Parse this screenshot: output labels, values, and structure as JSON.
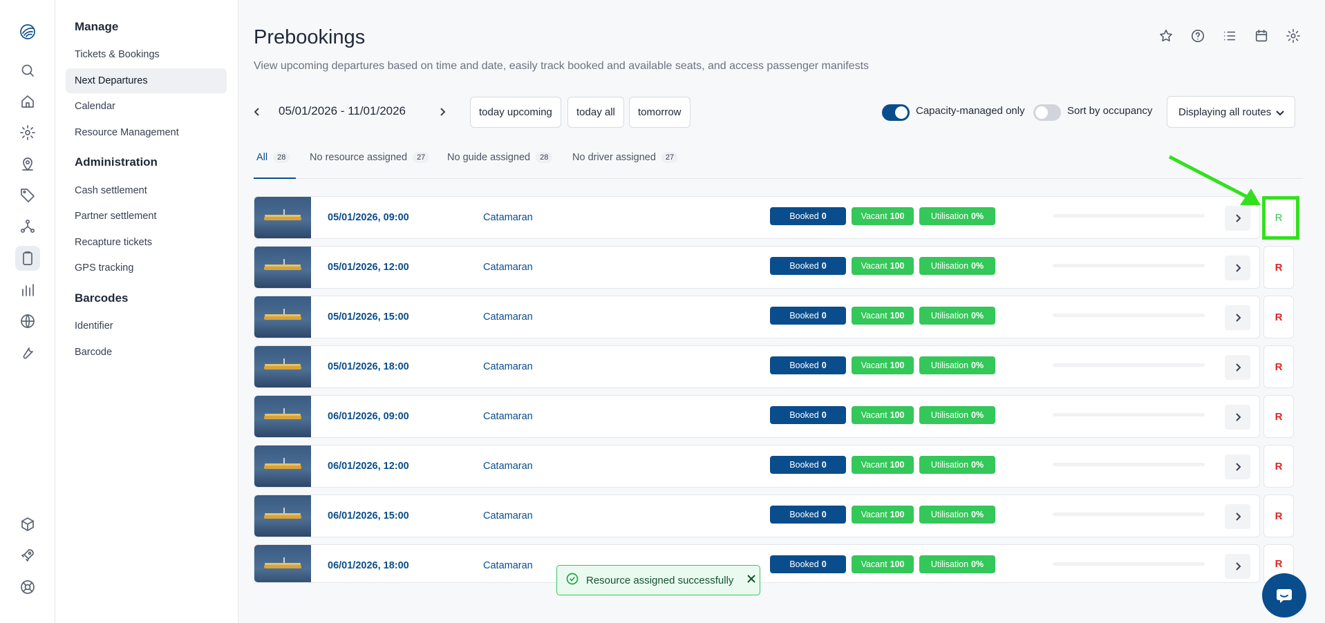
{
  "sidebar_icons": [
    "logo-icon",
    "search-icon",
    "home-icon",
    "gear-icon",
    "user-location-icon",
    "tag-icon",
    "network-icon",
    "clipboard-icon",
    "bar-chart-icon",
    "globe-icon",
    "wrench-icon",
    "cube-icon",
    "rocket-icon",
    "lifebuoy-icon"
  ],
  "subnav": {
    "manage_title": "Manage",
    "manage_items": [
      "Tickets & Bookings",
      "Next Departures",
      "Calendar",
      "Resource Management"
    ],
    "admin_title": "Administration",
    "admin_items": [
      "Cash settlement",
      "Partner settlement",
      "Recapture tickets",
      "GPS tracking"
    ],
    "barcodes_title": "Barcodes",
    "barcodes_items": [
      "Identifier",
      "Barcode"
    ]
  },
  "header": {
    "title": "Prebookings",
    "subtitle": "View upcoming departures based on time and date, easily track booked and available seats, and access passenger manifests"
  },
  "toolbar": {
    "date_range": "05/01/2026 - 11/01/2026",
    "today_upcoming": "today upcoming",
    "today_all": "today all",
    "tomorrow": "tomorrow",
    "capacity_label": "Capacity-managed only",
    "capacity_on": true,
    "sort_label": "Sort by occupancy",
    "sort_on": false,
    "routes_label": "Displaying all routes"
  },
  "tabs": [
    {
      "label": "All",
      "count": "28"
    },
    {
      "label": "No resource assigned",
      "count": "27"
    },
    {
      "label": "No guide assigned",
      "count": "28"
    },
    {
      "label": "No driver assigned",
      "count": "27"
    }
  ],
  "badge_labels": {
    "booked": "Booked",
    "vacant": "Vacant",
    "utilisation": "Utilisation"
  },
  "rows": [
    {
      "datetime": "05/01/2026, 09:00",
      "resource": "Catamaran",
      "booked": "0",
      "vacant": "100",
      "utilisation": "0%",
      "r": "R",
      "assigned": true
    },
    {
      "datetime": "05/01/2026, 12:00",
      "resource": "Catamaran",
      "booked": "0",
      "vacant": "100",
      "utilisation": "0%",
      "r": "R",
      "assigned": false
    },
    {
      "datetime": "05/01/2026, 15:00",
      "resource": "Catamaran",
      "booked": "0",
      "vacant": "100",
      "utilisation": "0%",
      "r": "R",
      "assigned": false
    },
    {
      "datetime": "05/01/2026, 18:00",
      "resource": "Catamaran",
      "booked": "0",
      "vacant": "100",
      "utilisation": "0%",
      "r": "R",
      "assigned": false
    },
    {
      "datetime": "06/01/2026, 09:00",
      "resource": "Catamaran",
      "booked": "0",
      "vacant": "100",
      "utilisation": "0%",
      "r": "R",
      "assigned": false
    },
    {
      "datetime": "06/01/2026, 12:00",
      "resource": "Catamaran",
      "booked": "0",
      "vacant": "100",
      "utilisation": "0%",
      "r": "R",
      "assigned": false
    },
    {
      "datetime": "06/01/2026, 15:00",
      "resource": "Catamaran",
      "booked": "0",
      "vacant": "100",
      "utilisation": "0%",
      "r": "R",
      "assigned": false
    },
    {
      "datetime": "06/01/2026, 18:00",
      "resource": "Catamaran",
      "booked": "0",
      "vacant": "100",
      "utilisation": "0%",
      "r": "R",
      "assigned": false
    }
  ],
  "toast": {
    "message": "Resource assigned successfully"
  },
  "colors": {
    "primary": "#0a4d8c",
    "success": "#34c759",
    "danger": "#e02424",
    "highlight": "#34e01e"
  }
}
